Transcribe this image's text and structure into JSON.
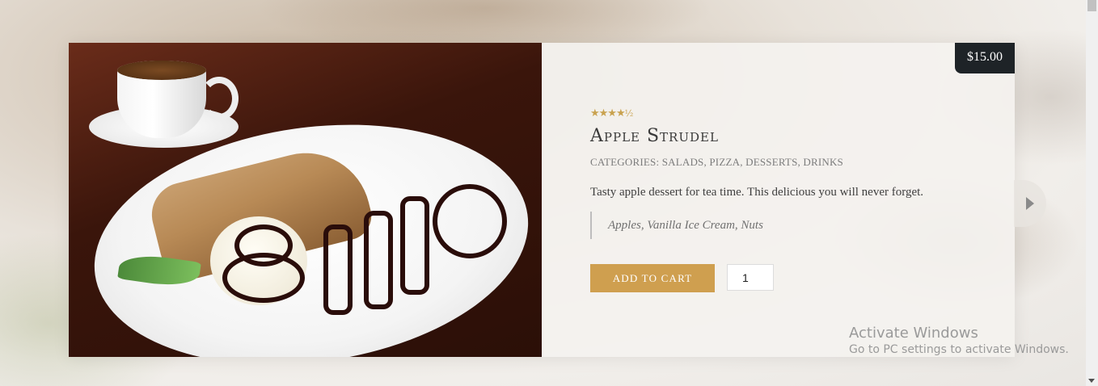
{
  "product": {
    "price": "$15.00",
    "rating_stars": "★★★★",
    "rating_half": "½",
    "rating_value": 4.5,
    "title": "Apple Strudel",
    "categories": "CATEGORIES: SALADS, PIZZA, DESSERTS, DRINKS",
    "description": "Tasty apple dessert for tea time. This delicious you will never forget.",
    "ingredients": "Apples, Vanilla Ice Cream, Nuts",
    "add_to_cart_label": "ADD TO CART",
    "quantity": "1"
  },
  "icons": {
    "next": "caret-right-icon",
    "rating": "star-icon"
  },
  "watermark": {
    "title": "Activate Windows",
    "subtitle": "Go to PC settings to activate Windows."
  },
  "colors": {
    "accent": "#cf9f4f",
    "price_badge": "#1e2327",
    "text": "#3a3a3a"
  }
}
